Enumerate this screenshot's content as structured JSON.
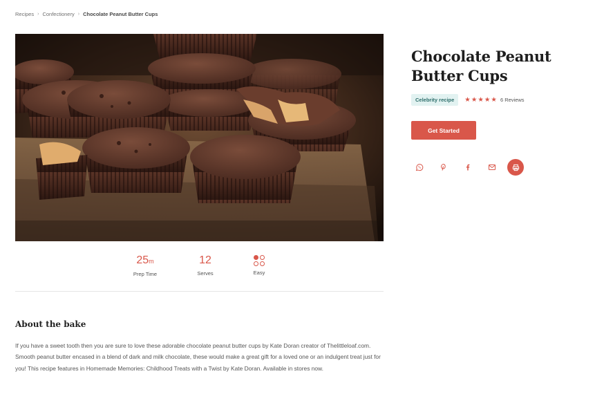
{
  "breadcrumb": {
    "items": [
      "Recipes",
      "Confectionery"
    ],
    "current": "Chocolate Peanut Butter Cups"
  },
  "hero": {
    "alt": "Chocolate peanut butter cups on a wooden board"
  },
  "stats": {
    "prep": {
      "value": "25",
      "unit": "m",
      "label": "Prep Time"
    },
    "serves": {
      "value": "12",
      "label": "Serves"
    },
    "difficulty": {
      "label": "Easy",
      "icon": "difficulty-dots-icon"
    }
  },
  "about": {
    "title": "About the bake",
    "text": "If you have a sweet tooth then you are sure to love these adorable chocolate peanut butter cups by Kate Doran creator of Thelittleloaf.com. Smooth peanut butter encased in a blend of dark and milk chocolate, these would make a great gift for a loved one or an indulgent treat just for you! This recipe features in Homemade Memories: Childhood Treats with a Twist by Kate Doran. Available in stores now."
  },
  "recipe": {
    "title": "Chocolate Peanut Butter Cups",
    "badge": "Celebrity recipe",
    "rating": 5,
    "reviews": "6 Reviews",
    "cta": "Get Started"
  },
  "share": {
    "icons": [
      "whatsapp-icon",
      "pinterest-icon",
      "facebook-icon",
      "email-icon",
      "print-icon"
    ]
  },
  "colors": {
    "accent": "#d9574a",
    "badge_bg": "#e2f2f1",
    "badge_text": "#2e6f6c",
    "text": "#3a3a3a"
  }
}
